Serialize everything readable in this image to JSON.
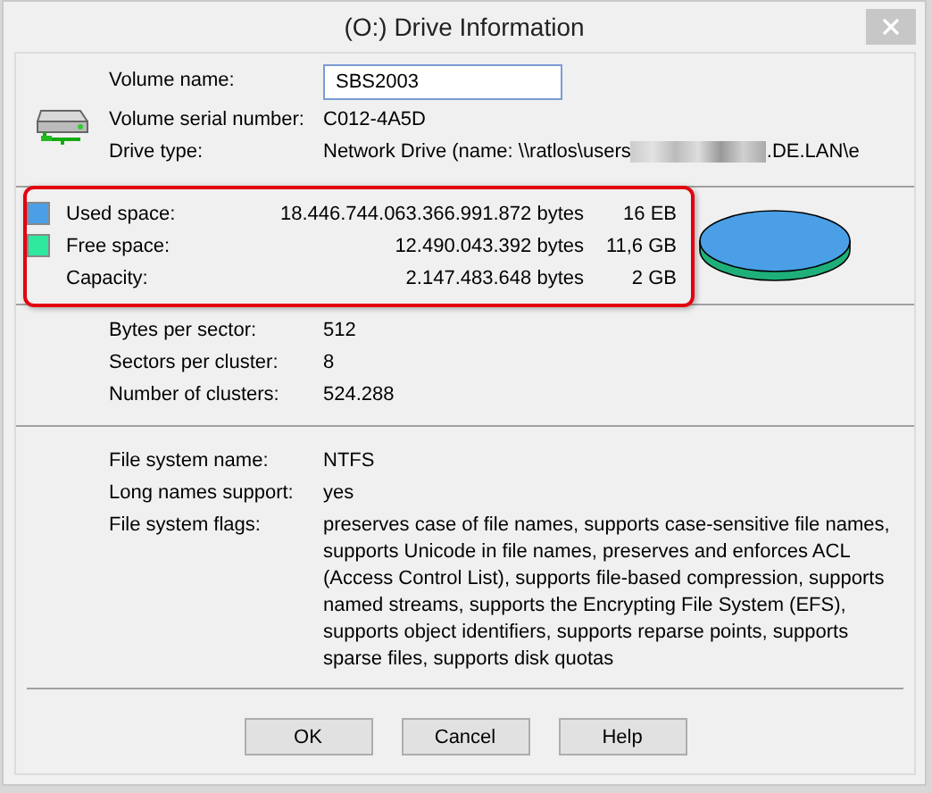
{
  "window": {
    "title": "(O:) Drive Information"
  },
  "volume": {
    "name_label": "Volume name:",
    "name_value": "SBS2003",
    "serial_label": "Volume serial number:",
    "serial_value": "C012-4A5D",
    "type_label": "Drive type:",
    "type_value_start": "Network Drive (name: \\\\ratlos\\users",
    "type_value_end": ".DE.LAN\\e"
  },
  "space": {
    "highlighted": true,
    "rows": [
      {
        "label": "Used space:",
        "bytes": "18.446.744.063.366.991.872 bytes",
        "size": "16 EB",
        "color": "#4a9fe6"
      },
      {
        "label": "Free space:",
        "bytes": "12.490.043.392 bytes",
        "size": "11,6 GB",
        "color": "#2ee89e"
      },
      {
        "label": "Capacity:",
        "bytes": "2.147.483.648 bytes",
        "size": "2 GB"
      }
    ]
  },
  "geometry": [
    {
      "label": "Bytes per sector:",
      "value": "512"
    },
    {
      "label": "Sectors per cluster:",
      "value": "8"
    },
    {
      "label": "Number of clusters:",
      "value": "524.288"
    }
  ],
  "file_system": [
    {
      "label": "File system name:",
      "value": "NTFS"
    },
    {
      "label": "Long names support:",
      "value": "yes"
    },
    {
      "label": "File system flags:",
      "value": "preserves case of file names, supports case-sensitive file names, supports Unicode in file names, preserves and enforces ACL (Access Control List), supports file-based compression, supports named streams, supports the Encrypting File System (EFS), supports object identifiers, supports reparse points, supports sparse files, supports disk quotas"
    }
  ],
  "buttons": [
    "OK",
    "Cancel",
    "Help"
  ]
}
